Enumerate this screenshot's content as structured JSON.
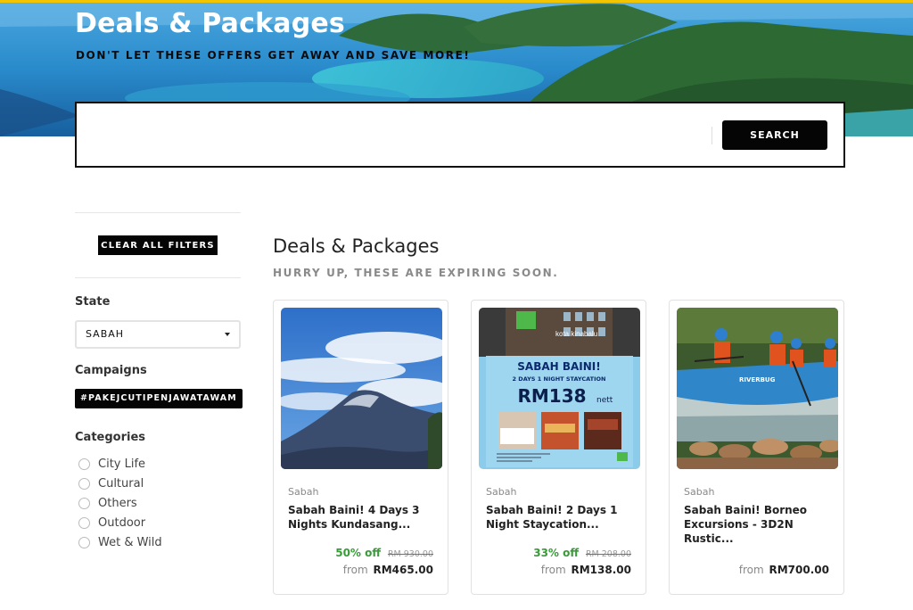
{
  "hero": {
    "title": "Deals & Packages",
    "subtitle": "DON'T LET THESE OFFERS GET AWAY AND SAVE MORE!"
  },
  "search": {
    "placeholder": "",
    "value": "",
    "button_label": "SEARCH"
  },
  "sidebar": {
    "clear_filters_label": "CLEAR ALL FILTERS",
    "state_label": "State",
    "state_selected": "SABAH",
    "campaigns_label": "Campaigns",
    "campaign_tag": "#PAKEJCUTIPENJAWATAWAM",
    "categories_label": "Categories",
    "categories": [
      "City Life",
      "Cultural",
      "Others",
      "Outdoor",
      "Wet & Wild"
    ]
  },
  "main": {
    "title": "Deals & Packages",
    "subtitle": "HURRY UP, THESE ARE EXPIRING SOON.",
    "cards": [
      {
        "state": "Sabah",
        "title": "Sabah Baini! 4 Days 3 Nights Kundasang...",
        "discount": "50% off",
        "original_price": "RM 930.00",
        "from_label": "from",
        "price": "RM465.00"
      },
      {
        "state": "Sabah",
        "title": "Sabah Baini! 2 Days 1 Night Staycation...",
        "discount": "33% off",
        "original_price": "RM 208.00",
        "from_label": "from",
        "price": "RM138.00",
        "image_text": {
          "hotel": "kota kinabalu",
          "headline": "SABAH BAINI!",
          "tagline": "2 DAYS 1 NIGHT STAYCATION",
          "price": "RM138",
          "price_suffix": "nett"
        }
      },
      {
        "state": "Sabah",
        "title": "Sabah Baini! Borneo Excursions - 3D2N Rustic...",
        "from_label": "from",
        "price": "RM700.00",
        "image_text": {
          "raft": "RIVERBUG"
        }
      }
    ]
  },
  "colors": {
    "accent_bar": "#f3c400",
    "button_bg": "#050505",
    "discount_green": "#3a9a3a",
    "strike_red": "#e04040"
  }
}
